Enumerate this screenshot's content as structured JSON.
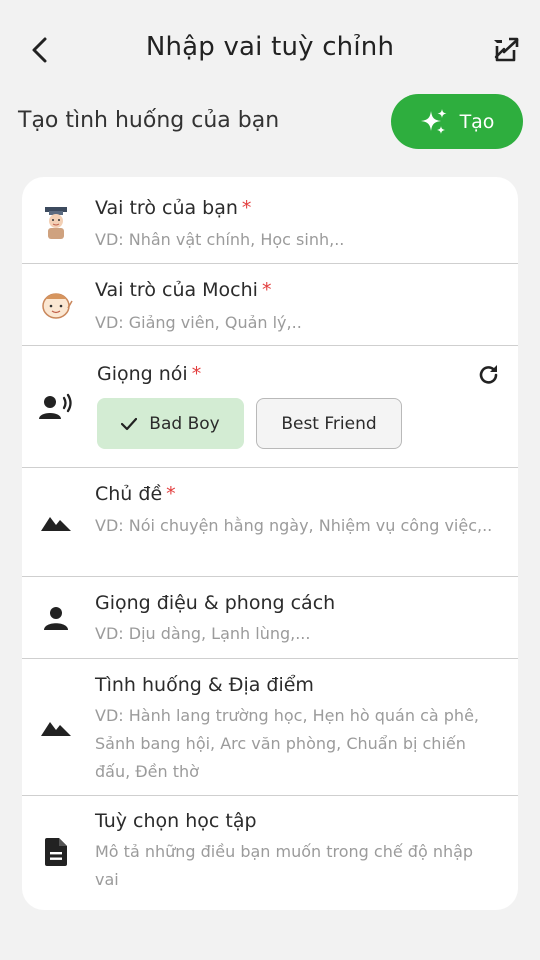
{
  "header": {
    "title": "Nhập vai tuỳ chỉnh",
    "back_icon": "arrow-back-icon",
    "action_icon": "external-link-icon"
  },
  "section": {
    "title": "Tạo tình huống của bạn",
    "create_label": "Tạo",
    "create_icon": "sparkles-icon",
    "create_color": "#2eae3e"
  },
  "rows": {
    "your_role": {
      "title": "Vai trò của bạn",
      "required": "*",
      "placeholder": "VD: Nhân vật chính, Học sinh,..",
      "icon": "student-avatar-icon"
    },
    "mochi_role": {
      "title": "Vai trò của Mochi",
      "required": "*",
      "placeholder": "VD: Giảng viên, Quản lý,..",
      "icon": "mochi-avatar-icon"
    },
    "voice": {
      "title": "Giọng nói",
      "required": "*",
      "icon": "speaker-person-icon",
      "refresh_icon": "refresh-icon",
      "options": [
        {
          "label": "Bad Boy",
          "selected": true
        },
        {
          "label": "Best Friend",
          "selected": false
        }
      ]
    },
    "topic": {
      "title": "Chủ đề",
      "required": "*",
      "placeholder": "VD: Nói chuyện hằng ngày, Nhiệm vụ công việc,..",
      "icon": "mountain-icon"
    },
    "tone": {
      "title": "Giọng điệu & phong cách",
      "placeholder": "VD: Dịu dàng, Lạnh lùng,...",
      "icon": "person-icon"
    },
    "situation": {
      "title": "Tình huống & Địa điểm",
      "placeholder": "VD: Hành lang trường học, Hẹn hò quán cà phê, Sảnh bang hội, Arc văn phòng, Chuẩn bị chiến đấu, Đền thờ",
      "icon": "mountain-icon"
    },
    "learning": {
      "title": "Tuỳ chọn học tập",
      "placeholder": "Mô tả những điều bạn muốn trong chế độ nhập vai",
      "icon": "document-icon"
    }
  }
}
